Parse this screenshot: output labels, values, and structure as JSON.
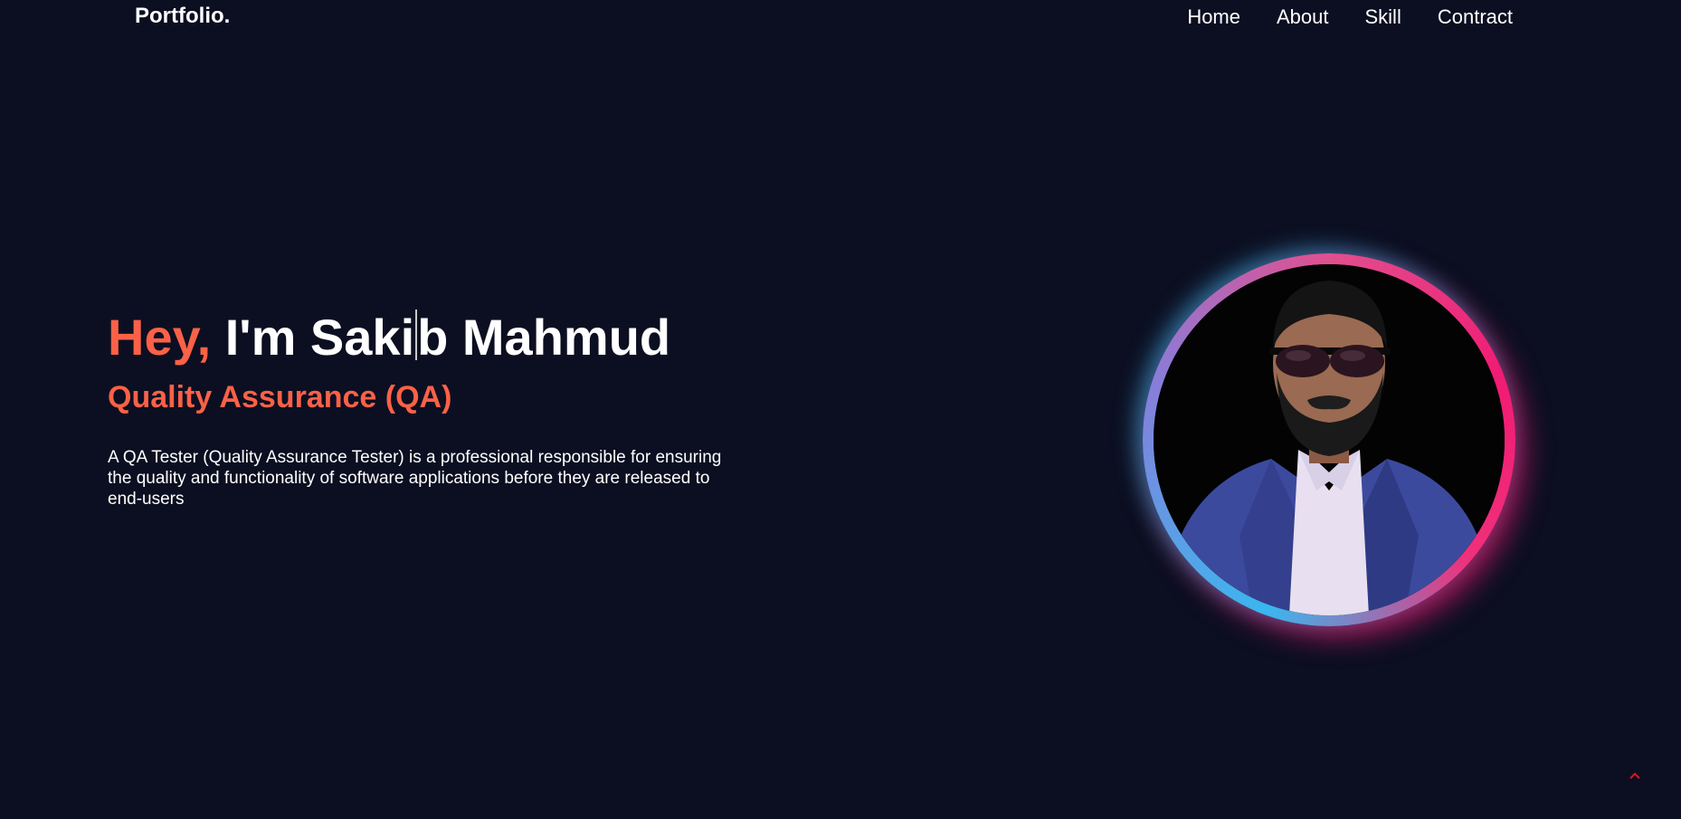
{
  "nav": {
    "logo": "Portfolio.",
    "links": [
      "Home",
      "About",
      "Skill",
      "Contract"
    ]
  },
  "hero": {
    "greeting": "Hey,",
    "name_part1": "I'm Saki",
    "name_part2": "b Mahmud",
    "role": "Quality Assurance (QA)",
    "description": "A QA Tester (Quality Assurance Tester) is a professional responsible for ensuring the quality and functionality of software applications before they are released to end-users"
  },
  "colors": {
    "background": "#0c0f21",
    "accent": "#fb6147",
    "ring_blue": "#3ab7ef",
    "ring_pink": "#f11b73"
  },
  "icons": {
    "scroll_top": "chevron-up-icon"
  }
}
